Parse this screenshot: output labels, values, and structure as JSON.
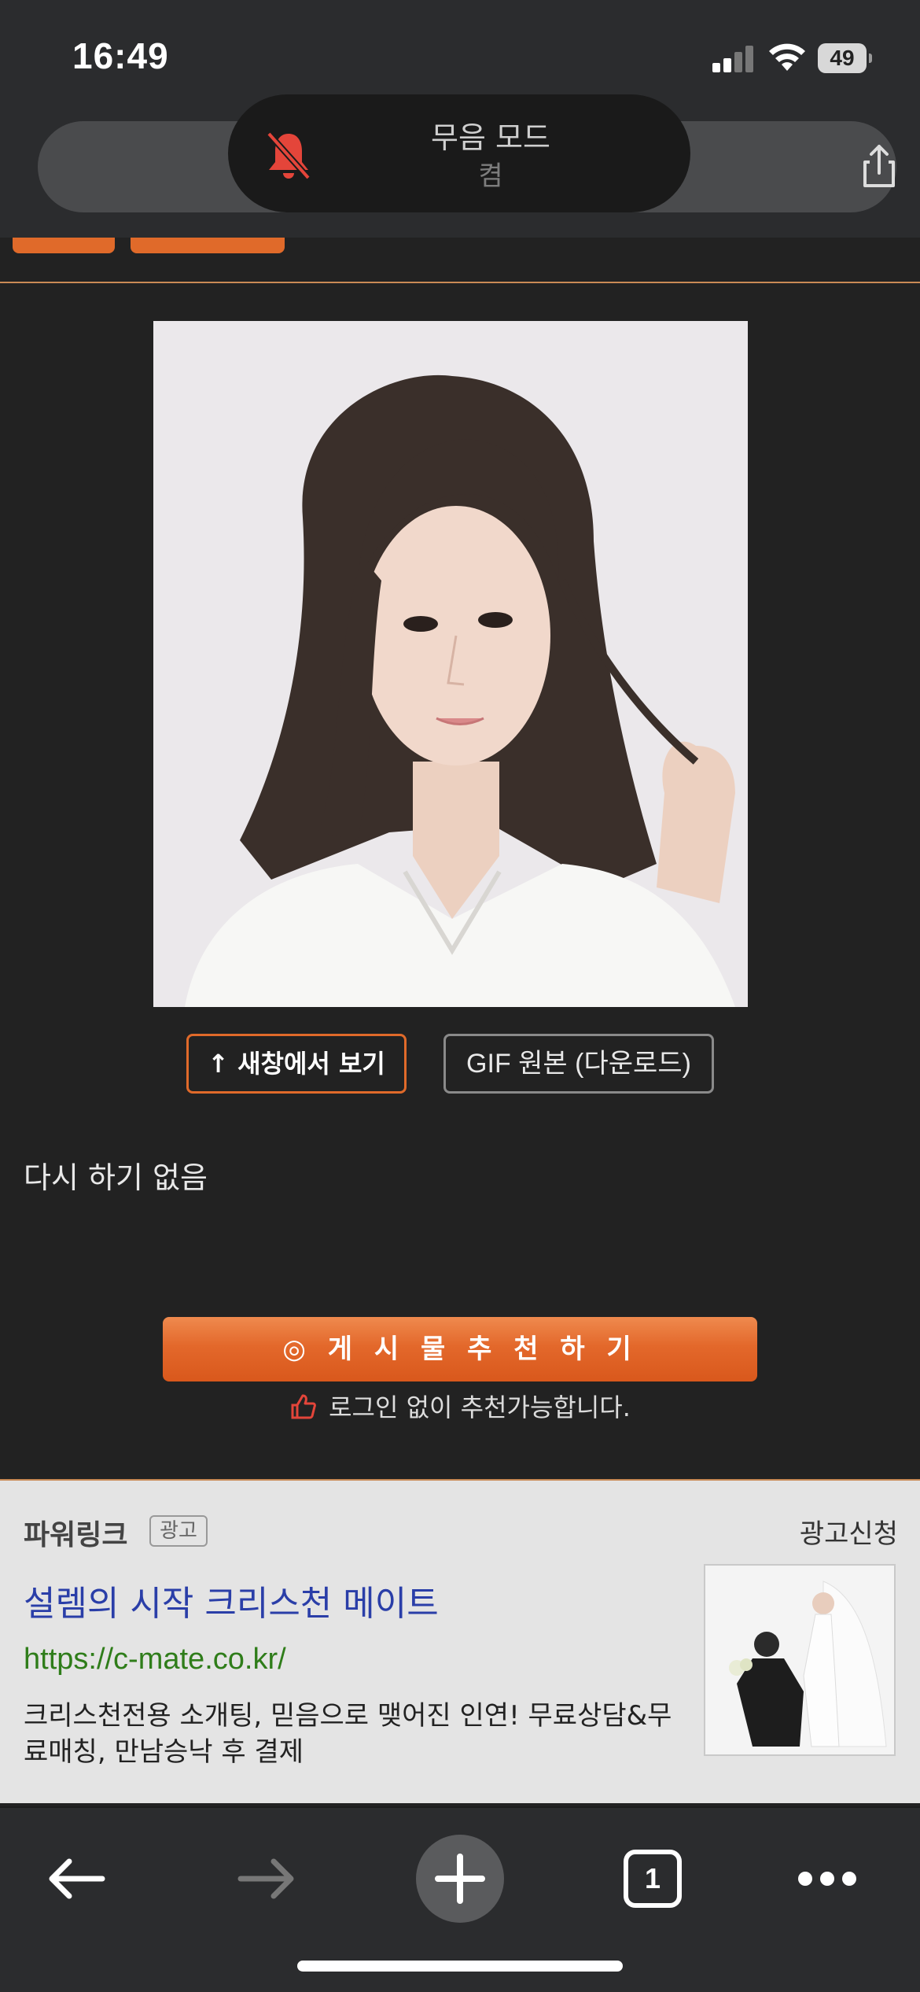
{
  "status_bar": {
    "time": "16:49",
    "battery": "49"
  },
  "silent_mode": {
    "title": "무음 모드",
    "state": "켬"
  },
  "post": {
    "open_new_window_label": "↑ 새창에서 보기",
    "gif_original_label": "GIF 원본 (다운로드)",
    "body_text": "다시 하기 없음",
    "recommend_label": "◎ 게 시 물   추 천 하 기",
    "recommend_note": "로그인 없이 추천가능합니다."
  },
  "ad": {
    "label": "파워링크",
    "badge": "광고",
    "apply": "광고신청",
    "title": "설렘의 시작 크리스천 메이트",
    "url": "https://c-mate.co.kr/",
    "description": "크리스천전용 소개팅, 믿음으로 맺어진 인연! 무료상담&무료매칭, 만남승낙 후 결제"
  },
  "toolbar": {
    "tab_count": "1"
  },
  "colors": {
    "accent": "#e06a2a",
    "background": "#222222",
    "ad_title": "#2a3ea8",
    "ad_url": "#2f7d1a"
  }
}
